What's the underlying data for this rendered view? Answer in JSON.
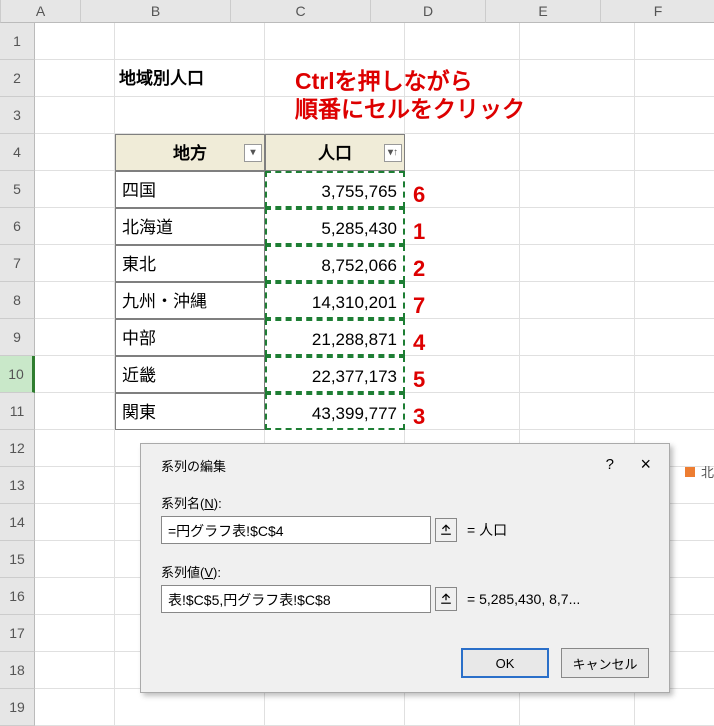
{
  "columns": [
    "A",
    "B",
    "C",
    "D",
    "E",
    "F"
  ],
  "rows": [
    "1",
    "2",
    "3",
    "4",
    "5",
    "6",
    "7",
    "8",
    "9",
    "10",
    "11",
    "12",
    "13",
    "14",
    "15",
    "16",
    "17",
    "18",
    "19"
  ],
  "title": "地域別人口",
  "headers": {
    "region": "地方",
    "pop": "人口"
  },
  "data": [
    {
      "region": "四国",
      "pop": "3,755,765",
      "order": "6"
    },
    {
      "region": "北海道",
      "pop": "5,285,430",
      "order": "1"
    },
    {
      "region": "東北",
      "pop": "8,752,066",
      "order": "2"
    },
    {
      "region": "九州・沖縄",
      "pop": "14,310,201",
      "order": "7"
    },
    {
      "region": "中部",
      "pop": "21,288,871",
      "order": "4"
    },
    {
      "region": "近畿",
      "pop": "22,377,173",
      "order": "5"
    },
    {
      "region": "関東",
      "pop": "43,399,777",
      "order": "3"
    }
  ],
  "annotation": {
    "line1": "Ctrlを押しながら",
    "line2": "順番にセルをクリック"
  },
  "dialog": {
    "title": "系列の編集",
    "help": "?",
    "close": "×",
    "name_label_pre": "系列名(",
    "name_label_u": "N",
    "name_label_post": "):",
    "name_value": "=円グラフ表!$C$4",
    "name_preview": "= 人口",
    "val_label_pre": "系列値(",
    "val_label_u": "V",
    "val_label_post": "):",
    "val_value": "表!$C$5,円グラフ表!$C$8",
    "val_preview": "= 5,285,430, 8,7...",
    "ok": "OK",
    "cancel": "キャンセル"
  },
  "legend_cut": "北"
}
